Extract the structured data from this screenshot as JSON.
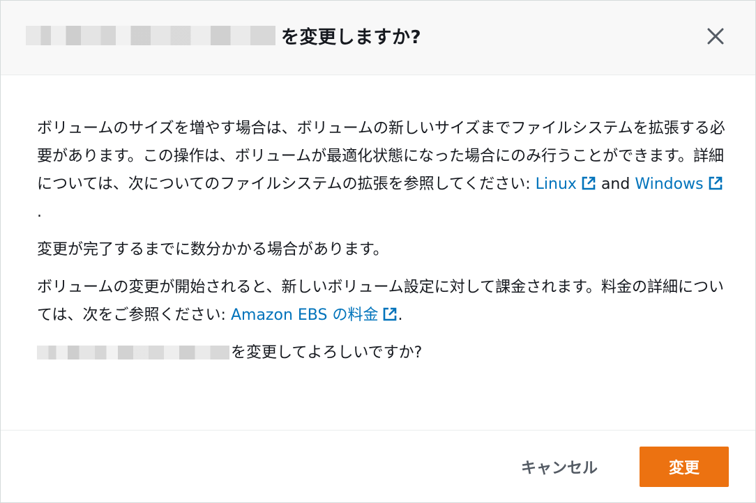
{
  "dialog": {
    "title_suffix": "を変更しますか?",
    "close_icon": "close-icon"
  },
  "body": {
    "para1_text": "ボリュームのサイズを増やす場合は、ボリュームの新しいサイズまでファイルシステムを拡張する必要があります。この操作は、ボリュームが最適化状態になった場合にのみ行うことができます。詳細については、次についてのファイルシステムの拡張を参照してください: ",
    "link_linux": "Linux",
    "and_text": " and ",
    "link_windows": "Windows",
    "para1_end": " .",
    "para2_text": "変更が完了するまでに数分かかる場合があります。",
    "para3_text": "ボリュームの変更が開始されると、新しいボリューム設定に対して課金されます。料金の詳細については、次をご参照ください: ",
    "link_pricing": "Amazon EBS の料金",
    "para3_end": ".",
    "para4_text": "を変更してよろしいですか?"
  },
  "footer": {
    "cancel_label": "キャンセル",
    "confirm_label": "変更"
  },
  "colors": {
    "link": "#0073bb",
    "primary_button": "#ec7211",
    "header_bg": "#f8f8f8"
  },
  "icons": [
    "close-icon",
    "external-link-icon"
  ]
}
